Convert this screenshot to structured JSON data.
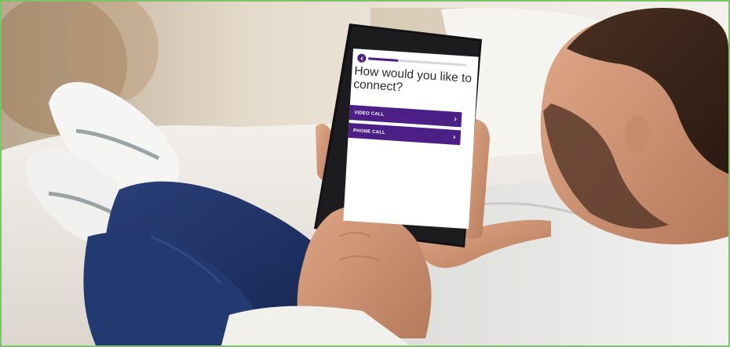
{
  "screen": {
    "question": "How would you like to connect?",
    "progress_fraction": 0.3,
    "options": [
      {
        "label": "VIDEO CALL",
        "icon": "chevron-right-icon"
      },
      {
        "label": "PHONE CALL",
        "icon": "chevron-right-icon"
      }
    ]
  },
  "colors": {
    "border": "#7cc36a",
    "accent": "#4b1f86"
  }
}
